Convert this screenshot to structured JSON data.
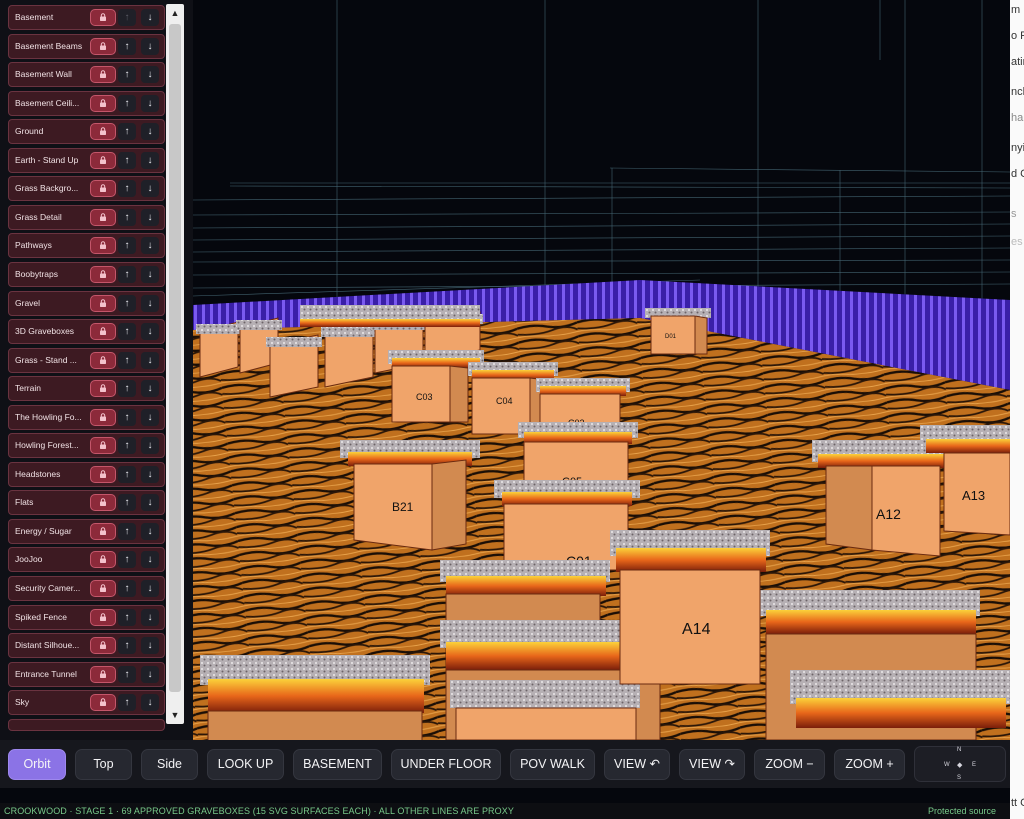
{
  "layers": [
    {
      "name": "Basement",
      "up_enabled": false
    },
    {
      "name": "Basement Beams",
      "up_enabled": true
    },
    {
      "name": "Basement Wall",
      "up_enabled": true
    },
    {
      "name": "Basement Ceili...",
      "up_enabled": true
    },
    {
      "name": "Ground",
      "up_enabled": true
    },
    {
      "name": "Earth - Stand Up",
      "up_enabled": true
    },
    {
      "name": "Grass Backgro...",
      "up_enabled": true
    },
    {
      "name": "Grass Detail",
      "up_enabled": true
    },
    {
      "name": "Pathways",
      "up_enabled": true
    },
    {
      "name": "Boobytraps",
      "up_enabled": true
    },
    {
      "name": "Gravel",
      "up_enabled": true
    },
    {
      "name": "3D Graveboxes",
      "up_enabled": true
    },
    {
      "name": "Grass - Stand ...",
      "up_enabled": true
    },
    {
      "name": "Terrain",
      "up_enabled": true
    },
    {
      "name": "The Howling Fo...",
      "up_enabled": true
    },
    {
      "name": "Howling Forest...",
      "up_enabled": true
    },
    {
      "name": "Headstones",
      "up_enabled": true
    },
    {
      "name": "Flats",
      "up_enabled": true
    },
    {
      "name": "Energy / Sugar",
      "up_enabled": true
    },
    {
      "name": "JooJoo",
      "up_enabled": true
    },
    {
      "name": "Security Camer...",
      "up_enabled": true
    },
    {
      "name": "Spiked Fence",
      "up_enabled": true
    },
    {
      "name": "Distant Silhoue...",
      "up_enabled": true
    },
    {
      "name": "Entrance Tunnel",
      "up_enabled": true
    },
    {
      "name": "Sky",
      "up_enabled": true
    }
  ],
  "toolbar": {
    "buttons": [
      {
        "label": "Orbit",
        "active": true
      },
      {
        "label": "Top",
        "active": false
      },
      {
        "label": "Side",
        "active": false
      },
      {
        "label": "LOOK UP",
        "active": false
      },
      {
        "label": "BASEMENT",
        "active": false
      },
      {
        "label": "UNDER FLOOR",
        "active": false
      },
      {
        "label": "POV WALK",
        "active": false
      },
      {
        "label": "VIEW ↶",
        "active": false
      },
      {
        "label": "VIEW ↷",
        "active": false
      },
      {
        "label": "ZOOM −",
        "active": false
      },
      {
        "label": "ZOOM +",
        "active": false
      }
    ],
    "compass": {
      "n": "N",
      "w": "W",
      "e": "E",
      "s": "S"
    }
  },
  "status": {
    "left": "CROOKWOOD · STAGE 1 · 69 APPROVED GRAVEBOXES (15 SVG SURFACES EACH) · ALL OTHER LINES ARE PROXY",
    "right": "Protected source"
  },
  "scene": {
    "graveboxes": [
      {
        "label": "D01"
      },
      {
        "label": "C03"
      },
      {
        "label": "C04"
      },
      {
        "label": "C02"
      },
      {
        "label": "C05"
      },
      {
        "label": "B21"
      },
      {
        "label": "C01"
      },
      {
        "label": "A12"
      },
      {
        "label": "A13"
      },
      {
        "label": "A14"
      }
    ]
  },
  "colors": {
    "accent": "#8b73e6",
    "panel_row": "#3d1a22",
    "lock": "#8c2a3a",
    "status_text": "#78c98a",
    "fence": "#5b2fd0",
    "box": "#f0a46a"
  },
  "right_strip": [
    "m",
    "o R",
    "atin",
    "nch",
    "ha",
    "nyis",
    "d C",
    "s",
    "es",
    "tt C"
  ]
}
